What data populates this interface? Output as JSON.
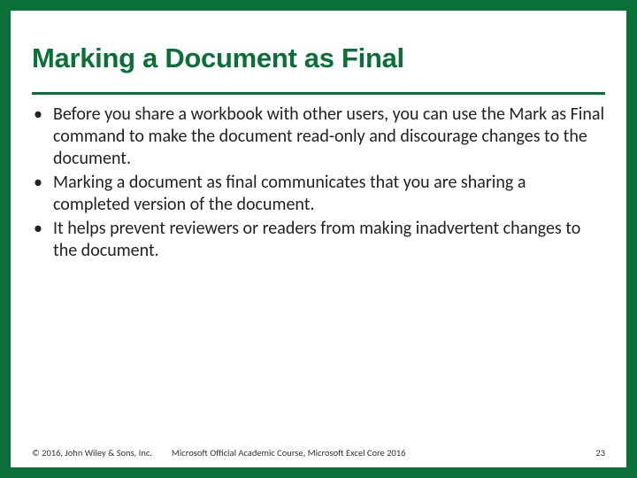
{
  "colors": {
    "brand_green": "#0b7038"
  },
  "title": "Marking a Document as Final",
  "bullets": [
    "Before you share a workbook with other users, you can use the Mark as Final command to make the document read-only and discourage changes to the document.",
    "Marking a document as final communicates that you are sharing a completed version of the document.",
    "It helps prevent reviewers or readers from making inadvertent changes to the document."
  ],
  "footer": {
    "copyright": "© 2016, John Wiley & Sons, Inc.",
    "course": "Microsoft Official Academic Course, Microsoft Excel Core 2016",
    "page_number": "23"
  }
}
